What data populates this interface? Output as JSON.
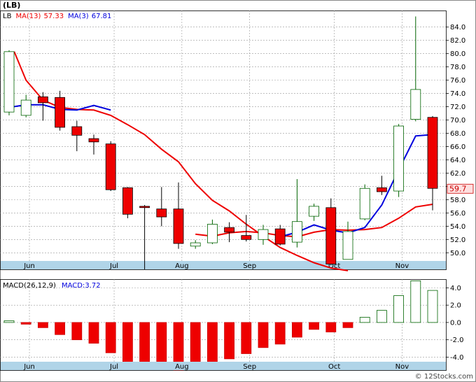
{
  "ticker_label": "(LB)",
  "watermark": "© 12Stocks.com",
  "colors": {
    "up_fill": "#ffffff",
    "up_stroke": "#006400",
    "down_fill": "#ee0000",
    "down_stroke": "#000000",
    "ma13": "#ee0000",
    "ma3": "#0000dd",
    "axis_band": "#b0d4e8",
    "grid": "#999999",
    "last_price_box": "#fde0e0"
  },
  "chart_data": [
    {
      "type": "candlestick",
      "legend": [
        {
          "label": "LB",
          "value": ""
        },
        {
          "label": "MA(13)",
          "value": "57.33"
        },
        {
          "label": "MA(3)",
          "value": "67.81"
        }
      ],
      "last_price_label": "59.7",
      "ylim": [
        47.5,
        86.5
      ],
      "y_ticks": [
        50.0,
        52.0,
        54.0,
        56.0,
        58.0,
        60.0,
        62.0,
        64.0,
        66.0,
        68.0,
        70.0,
        72.0,
        74.0,
        76.0,
        78.0,
        80.0,
        82.0,
        84.0
      ],
      "x_labels": [
        "Jun",
        "Jul",
        "Aug",
        "Sep",
        "Oct",
        "Nov"
      ],
      "x_label_weeks": [
        1.2,
        6.2,
        10.2,
        14.2,
        19.2,
        23.2
      ],
      "candles": [
        {
          "week": 0,
          "open": 71.2,
          "high": 80.5,
          "low": 70.7,
          "close": 80.3
        },
        {
          "week": 1,
          "open": 70.7,
          "high": 73.8,
          "low": 70.4,
          "close": 73.0
        },
        {
          "week": 2,
          "open": 73.5,
          "high": 74.2,
          "low": 69.9,
          "close": 72.6
        },
        {
          "week": 3,
          "open": 73.4,
          "high": 74.4,
          "low": 68.4,
          "close": 68.9
        },
        {
          "week": 4,
          "open": 69.0,
          "high": 69.9,
          "low": 65.3,
          "close": 67.7
        },
        {
          "week": 5,
          "open": 67.2,
          "high": 67.8,
          "low": 64.8,
          "close": 66.7
        },
        {
          "week": 6,
          "open": 66.4,
          "high": 66.8,
          "low": 59.3,
          "close": 59.5
        },
        {
          "week": 7,
          "open": 59.8,
          "high": 59.9,
          "low": 55.2,
          "close": 55.8
        },
        {
          "week": 8,
          "open": 57.0,
          "high": 57.2,
          "low": 47.5,
          "close": 56.8
        },
        {
          "week": 9,
          "open": 56.6,
          "high": 59.9,
          "low": 54.0,
          "close": 55.4
        },
        {
          "week": 10,
          "open": 56.6,
          "high": 60.6,
          "low": 50.6,
          "close": 51.4
        },
        {
          "week": 11,
          "open": 51.0,
          "high": 51.9,
          "low": 50.6,
          "close": 51.5
        },
        {
          "week": 12,
          "open": 51.5,
          "high": 55.0,
          "low": 51.3,
          "close": 54.3
        },
        {
          "week": 13,
          "open": 53.8,
          "high": 54.6,
          "low": 51.6,
          "close": 53.1
        },
        {
          "week": 14,
          "open": 52.6,
          "high": 55.7,
          "low": 51.7,
          "close": 52.0
        },
        {
          "week": 15,
          "open": 52.0,
          "high": 54.2,
          "low": 51.2,
          "close": 53.5
        },
        {
          "week": 16,
          "open": 53.6,
          "high": 54.2,
          "low": 51.1,
          "close": 51.3
        },
        {
          "week": 17,
          "open": 51.6,
          "high": 61.1,
          "low": 50.8,
          "close": 54.7
        },
        {
          "week": 18,
          "open": 55.5,
          "high": 57.4,
          "low": 54.8,
          "close": 57.0
        },
        {
          "week": 19,
          "open": 56.8,
          "high": 58.2,
          "low": 48.1,
          "close": 48.3
        },
        {
          "week": 20,
          "open": 49.0,
          "high": 54.7,
          "low": 49.0,
          "close": 53.2
        },
        {
          "week": 21,
          "open": 55.1,
          "high": 60.3,
          "low": 54.9,
          "close": 59.7
        },
        {
          "week": 22,
          "open": 59.8,
          "high": 61.6,
          "low": 58.7,
          "close": 59.2
        },
        {
          "week": 23,
          "open": 59.3,
          "high": 69.4,
          "low": 58.4,
          "close": 69.1
        },
        {
          "week": 24,
          "open": 70.1,
          "high": 85.6,
          "low": 69.8,
          "close": 74.6
        },
        {
          "week": 25,
          "open": 70.4,
          "high": 70.6,
          "low": 56.4,
          "close": 59.7
        }
      ],
      "ma13": [
        {
          "week": 0.3,
          "value": 80.3
        },
        {
          "week": 1,
          "value": 76.0
        },
        {
          "week": 2,
          "value": 73.0
        },
        {
          "week": 3,
          "value": 71.9
        },
        {
          "week": 4,
          "value": 71.6
        },
        {
          "week": 5,
          "value": 71.5
        },
        {
          "week": 6,
          "value": 70.7
        },
        {
          "week": 7,
          "value": 69.3
        },
        {
          "week": 8,
          "value": 67.8
        },
        {
          "week": 9,
          "value": 65.6
        },
        {
          "week": 10,
          "value": 63.7
        },
        {
          "week": 11,
          "value": 60.4
        },
        {
          "week": 12,
          "value": 57.9
        },
        {
          "week": 13,
          "value": 56.3
        },
        {
          "week": 14,
          "value": 54.3
        },
        {
          "week": 15,
          "value": 52.5
        },
        {
          "week": 16,
          "value": 50.8
        },
        {
          "week": 17,
          "value": 49.6
        },
        {
          "week": 18,
          "value": 48.5
        },
        {
          "week": 19,
          "value": 47.7
        },
        {
          "week": 20,
          "value": 47.3
        }
      ],
      "ma3": [
        {
          "week": 0,
          "value": 71.9
        },
        {
          "week": 1,
          "value": 72.3
        },
        {
          "week": 2,
          "value": 72.3
        },
        {
          "week": 3,
          "value": 71.6
        },
        {
          "week": 4,
          "value": 71.5
        },
        {
          "week": 5,
          "value": 72.2
        },
        {
          "week": 6,
          "value": 71.5
        }
      ],
      "ma3_segment_2": [
        {
          "week": 16,
          "value": 52.4
        },
        {
          "week": 17,
          "value": 53.1
        },
        {
          "week": 18,
          "value": 54.2
        },
        {
          "week": 19,
          "value": 53.4
        },
        {
          "week": 20,
          "value": 53.0
        },
        {
          "week": 21,
          "value": 53.8
        },
        {
          "week": 22,
          "value": 57.2
        },
        {
          "week": 23,
          "value": 62.5
        },
        {
          "week": 24,
          "value": 67.6
        },
        {
          "week": 25,
          "value": 67.8
        }
      ],
      "ma13_segment_2": [
        {
          "week": 11,
          "value": 52.8
        },
        {
          "week": 12,
          "value": 52.5
        },
        {
          "week": 13,
          "value": 53.0
        },
        {
          "week": 14,
          "value": 53.2
        },
        {
          "week": 15,
          "value": 53.0
        },
        {
          "week": 16,
          "value": 52.6
        },
        {
          "week": 17,
          "value": 52.4
        },
        {
          "week": 18,
          "value": 53.1
        },
        {
          "week": 19,
          "value": 53.5
        },
        {
          "week": 20,
          "value": 53.4
        },
        {
          "week": 21,
          "value": 53.5
        },
        {
          "week": 22,
          "value": 53.8
        },
        {
          "week": 23,
          "value": 55.2
        },
        {
          "week": 24,
          "value": 56.9
        },
        {
          "week": 25,
          "value": 57.3
        }
      ]
    },
    {
      "type": "bar",
      "legend": [
        {
          "label": "MACD(26,12,9)",
          "value": ""
        },
        {
          "label": "MACD:",
          "value": "3.72"
        }
      ],
      "ylim": [
        -5.5,
        5.0
      ],
      "y_ticks": [
        4.0,
        2.0,
        0.0,
        -2.0,
        -4.0
      ],
      "y_tick_labels": [
        "4.0",
        "2.0",
        "0.0",
        "-2.0",
        "-4.0"
      ],
      "x_labels": [
        "Jun",
        "Jul",
        "Aug",
        "Sep",
        "Oct",
        "Nov"
      ],
      "values": [
        0.2,
        -0.2,
        -0.6,
        -1.4,
        -2.0,
        -2.4,
        -3.5,
        -4.6,
        -5.1,
        -5.3,
        -5.5,
        -5.1,
        -4.7,
        -4.2,
        -3.6,
        -2.9,
        -2.5,
        -1.7,
        -0.8,
        -1.1,
        -0.6,
        0.6,
        1.4,
        3.1,
        4.8,
        3.7
      ],
      "labels": [
        "",
        "",
        "",
        "",
        "",
        "",
        "",
        "",
        "",
        "",
        "",
        "",
        "",
        "",
        "",
        "",
        "",
        "",
        "",
        "",
        "",
        "",
        "",
        "",
        "",
        ""
      ]
    }
  ]
}
